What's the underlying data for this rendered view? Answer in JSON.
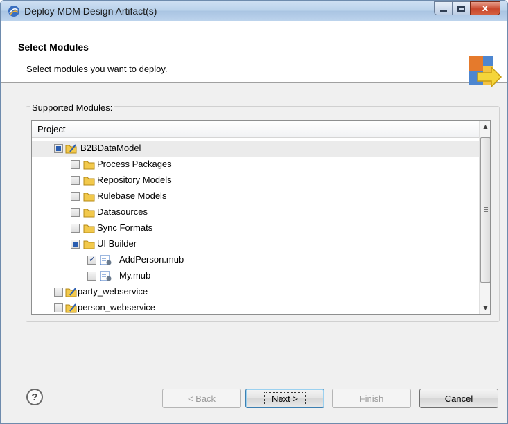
{
  "window": {
    "title": "Deploy MDM Design Artifact(s)",
    "close_label": "x"
  },
  "header": {
    "title": "Select Modules",
    "description": "Select modules you want to deploy."
  },
  "group": {
    "label": "Supported Modules:"
  },
  "tree": {
    "column_project": "Project",
    "rows": [
      {
        "label": "B2BDataModel",
        "state": "partial",
        "type": "project"
      },
      {
        "label": "Process Packages",
        "state": "unchecked",
        "type": "folder"
      },
      {
        "label": "Repository Models",
        "state": "unchecked",
        "type": "folder"
      },
      {
        "label": "Rulebase Models",
        "state": "unchecked",
        "type": "folder"
      },
      {
        "label": "Datasources",
        "state": "unchecked",
        "type": "folder"
      },
      {
        "label": "Sync Formats",
        "state": "unchecked",
        "type": "folder"
      },
      {
        "label": "UI Builder",
        "state": "partial",
        "type": "folder"
      },
      {
        "label": "AddPerson.mub",
        "state": "checked",
        "type": "file"
      },
      {
        "label": "My.mub",
        "state": "unchecked",
        "type": "file"
      },
      {
        "label": "party_webservice",
        "state": "unchecked",
        "type": "project"
      },
      {
        "label": "person_webservice",
        "state": "unchecked",
        "type": "project"
      }
    ]
  },
  "buttons": {
    "help": "?",
    "back_mnemonic": "B",
    "back_rest": "ack",
    "back_prefix": "< ",
    "next_mnemonic": "N",
    "next_rest": "ext >",
    "finish_mnemonic": "F",
    "finish_rest": "inish",
    "cancel": "Cancel"
  },
  "colors": {
    "accent": "#2a5db0",
    "folder": "#f2c94c"
  }
}
